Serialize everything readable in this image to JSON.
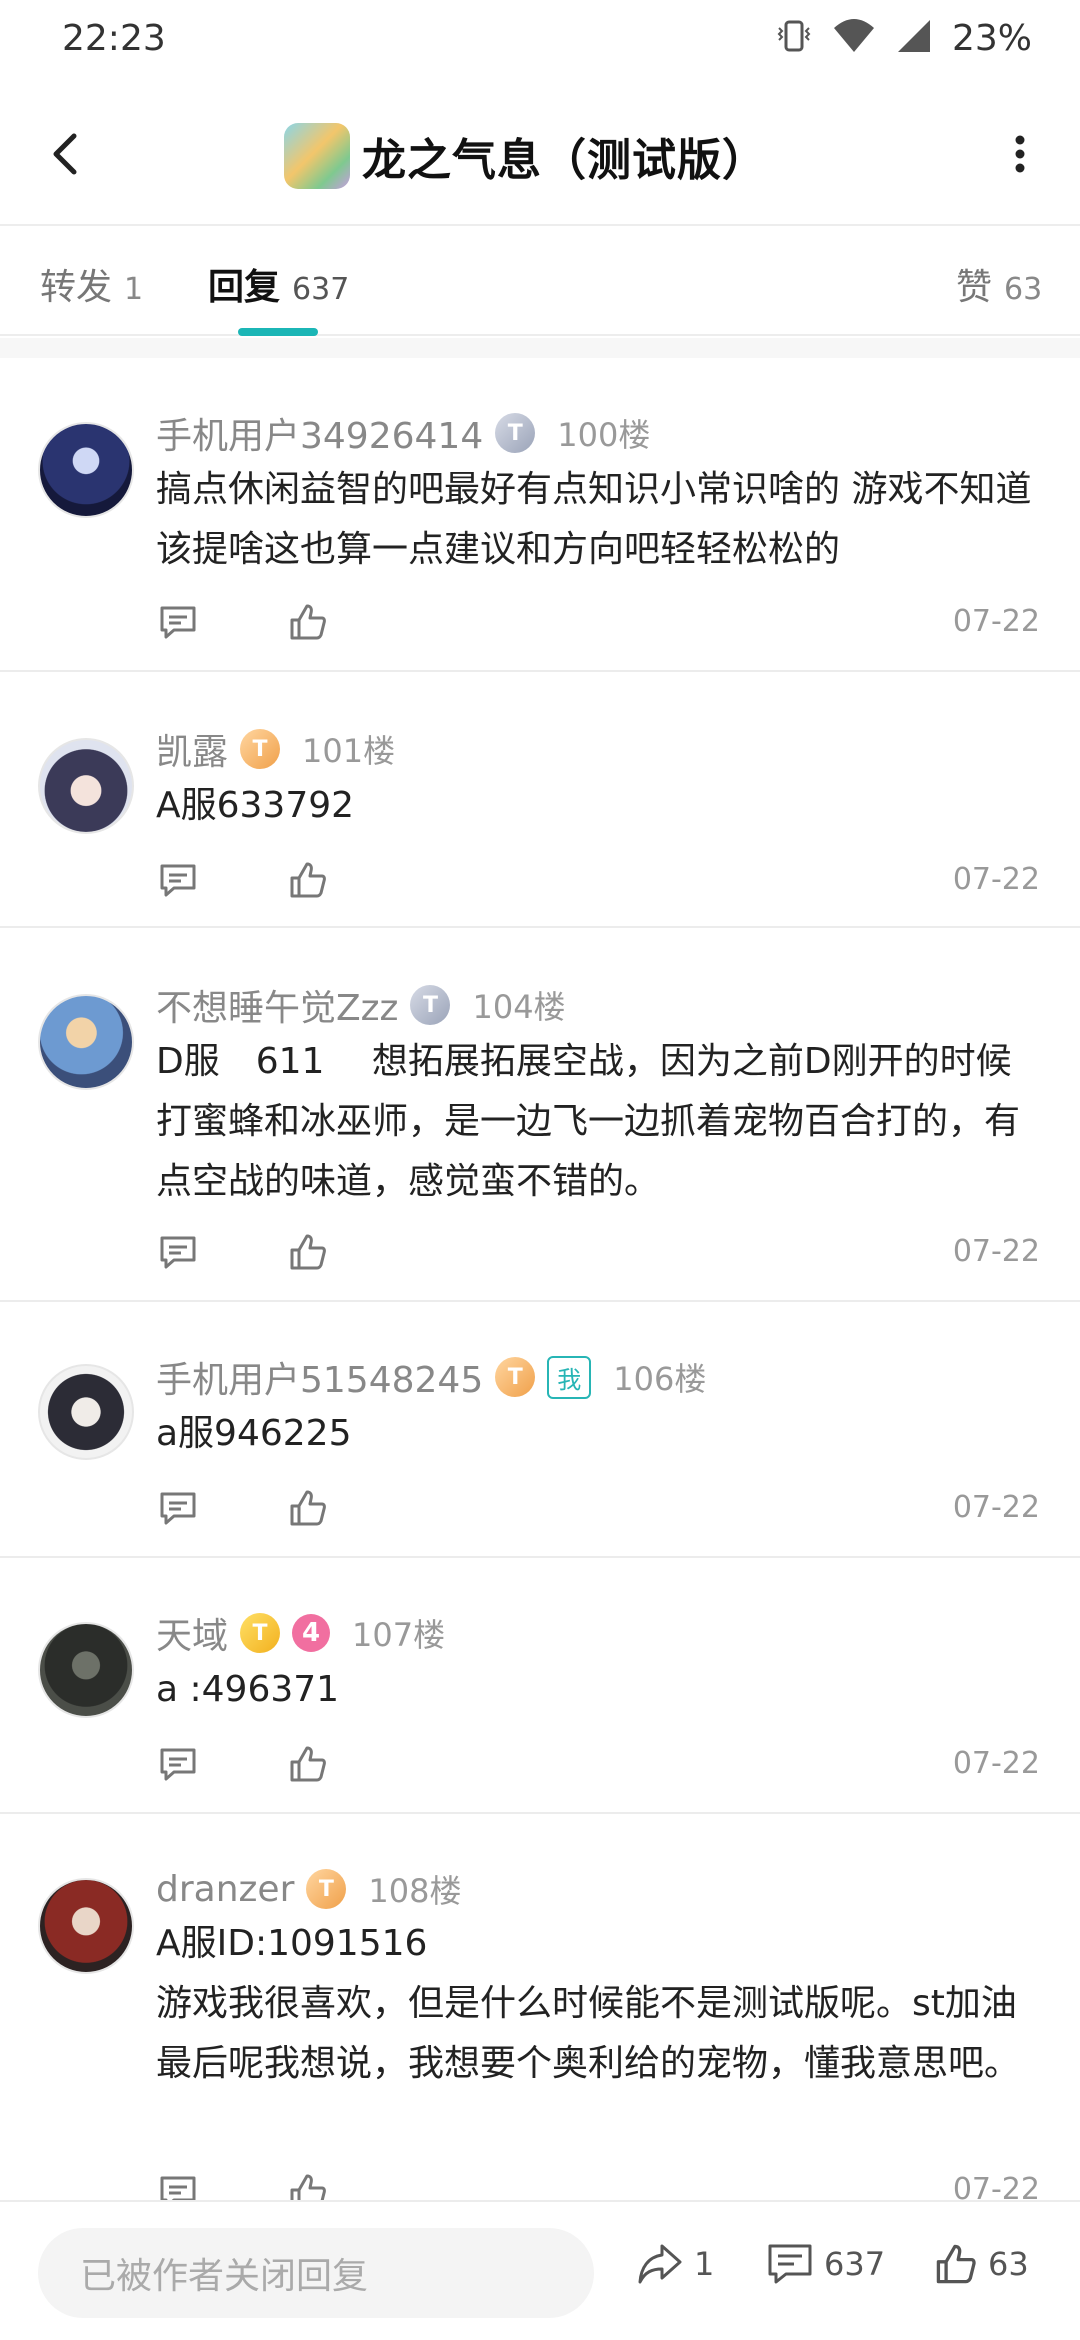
{
  "status_bar": {
    "time": "22:23",
    "battery": "23%"
  },
  "header": {
    "title": "龙之气息（测试版）"
  },
  "tabs": [
    {
      "label": "转发",
      "count": "1"
    },
    {
      "label": "回复",
      "count": "637"
    },
    {
      "label": "赞",
      "count": "63"
    }
  ],
  "posts": [
    {
      "username": "手机用户34926414",
      "level": "T",
      "floor": "100楼",
      "content": "搞点休闲益智的吧最好有点知识小常识啥的 游戏不知道该提啥这也算一点建议和方向吧轻轻松松的",
      "date": "07-22"
    },
    {
      "username": "凯露",
      "level": "T",
      "floor": "101楼",
      "content": "A服633792",
      "date": "07-22"
    },
    {
      "username": "不想睡午觉Zzz",
      "level": "T",
      "floor": "104楼",
      "content": "D服　611　 想拓展拓展空战，因为之前D刚开的时候打蜜蜂和冰巫师，是一边飞一边抓着宠物百合打的，有点空战的味道，感觉蛮不错的。",
      "date": "07-22"
    },
    {
      "username": "手机用户51548245",
      "level": "T",
      "me_badge": "我",
      "floor": "106楼",
      "content": "a服946225",
      "date": "07-22"
    },
    {
      "username": "天域",
      "level": "T",
      "extra_badge": "4",
      "floor": "107楼",
      "content": "a :496371",
      "date": "07-22"
    },
    {
      "username": "dranzer",
      "level": "T",
      "floor": "108楼",
      "content": "A服ID:1091516\n游戏我很喜欢，但是什么时候能不是测试版呢。st加油\n最后呢我想说，我想要个奥利给的宠物，懂我意思吧。",
      "date": "07-22"
    }
  ],
  "bottom_bar": {
    "reply_placeholder": "已被作者关闭回复",
    "share_count": "1",
    "comment_count": "637",
    "like_count": "63"
  },
  "colors": {
    "accent": "#1bb6b6",
    "me_badge": "#27b5b5",
    "pink_badge": "#f16fa0"
  }
}
